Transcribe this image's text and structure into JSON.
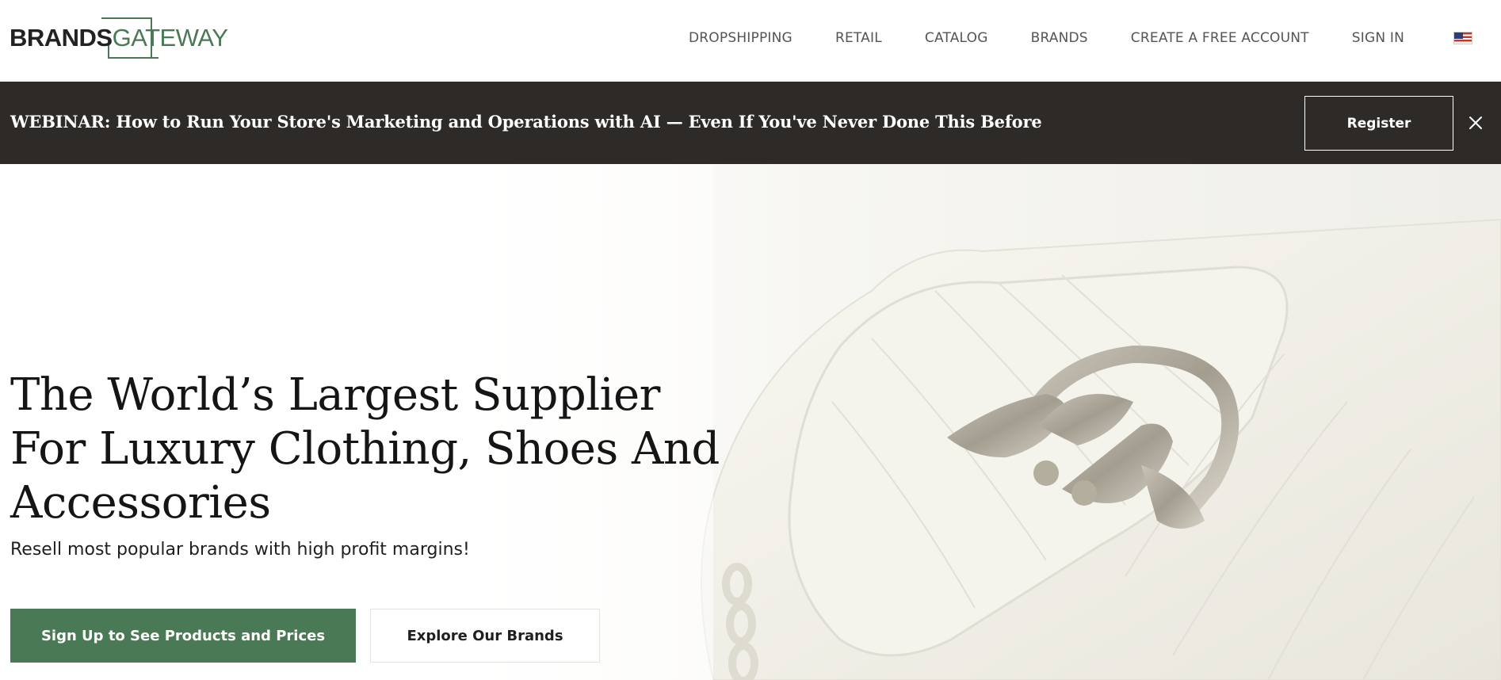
{
  "header": {
    "logo": {
      "brands": "BRANDS",
      "gateway": "GATEWAY"
    },
    "nav": [
      {
        "label": "DROPSHIPPING"
      },
      {
        "label": "RETAIL"
      },
      {
        "label": "CATALOG"
      },
      {
        "label": "BRANDS"
      },
      {
        "label": "CREATE A FREE ACCOUNT"
      },
      {
        "label": "SIGN IN"
      }
    ],
    "language_icon": "us-flag-icon"
  },
  "banner": {
    "text": "WEBINAR: How to Run Your Store's Marketing and Operations with AI — Even If You've Never Done This Before",
    "register_label": "Register",
    "close_icon": "close-icon"
  },
  "hero": {
    "title": "The World’s Largest Supplier For Luxury Clothing, Shoes And Accessories",
    "subtitle": "Resell most popular brands with high profit margins!",
    "primary_cta": "Sign Up to See Products and Prices",
    "secondary_cta": "Explore Our Brands",
    "image_description_icon": "white-quilted-handbag-image"
  },
  "colors": {
    "brand_green": "#4a7a55",
    "banner_bg": "#2d2a27",
    "nav_text": "#555555"
  }
}
